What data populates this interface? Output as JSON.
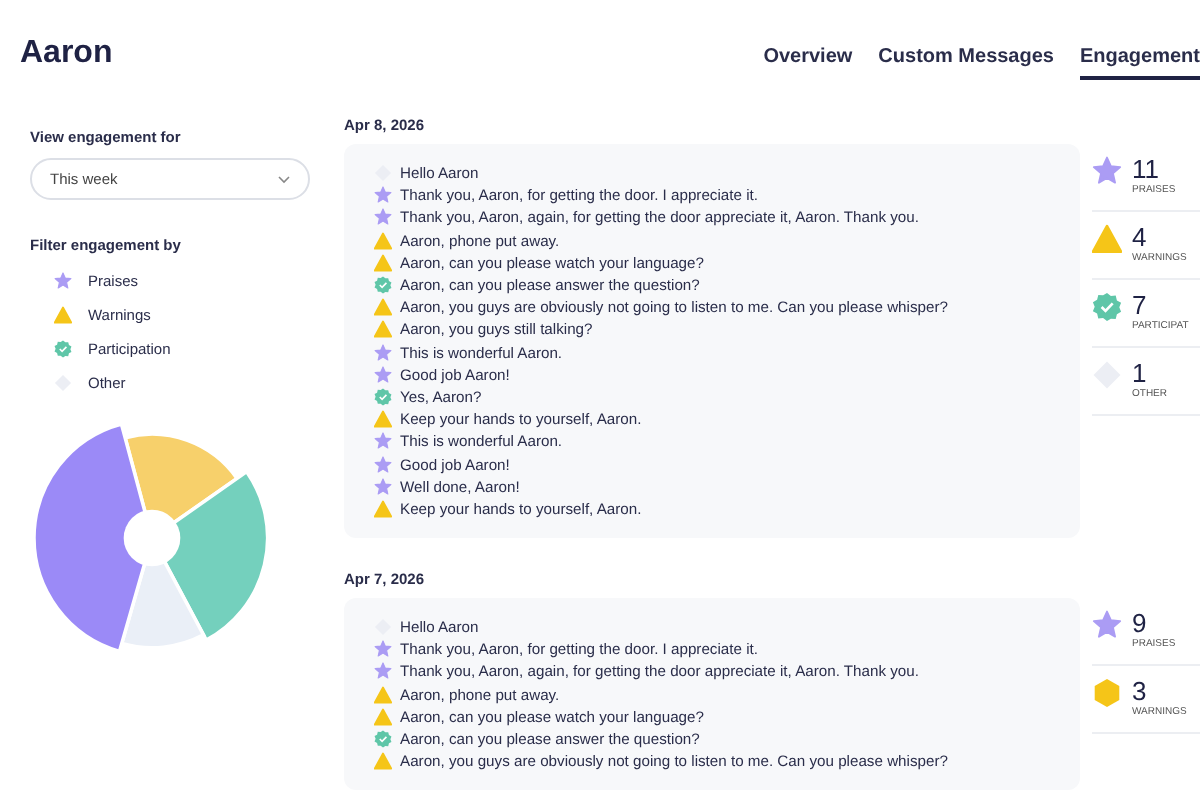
{
  "title": "Aaron",
  "tabs": [
    {
      "label": "Overview",
      "selected": false
    },
    {
      "label": "Custom Messages",
      "selected": false
    },
    {
      "label": "Engagement",
      "selected": true
    }
  ],
  "sidebar": {
    "period_label": "View engagement for",
    "period": {
      "value": "This week"
    },
    "filter_label": "Filter engagement by",
    "filters": [
      {
        "kind": "praise",
        "label": "Praises"
      },
      {
        "kind": "warning",
        "label": "Warnings"
      },
      {
        "kind": "participation",
        "label": "Participation"
      },
      {
        "kind": "other",
        "label": "Other"
      }
    ]
  },
  "days": [
    {
      "date": "Apr 8, 2026",
      "entries": [
        {
          "kind": "other",
          "text": "Hello Aaron"
        },
        {
          "kind": "praise",
          "text": "Thank you, Aaron, for getting the door. I appreciate it."
        },
        {
          "kind": "praise",
          "text": "Thank you, Aaron, again, for getting the door appreciate it, Aaron. Thank you."
        },
        {
          "kind": "warning",
          "text": "Aaron, phone put away."
        },
        {
          "kind": "warning",
          "text": "Aaron, can you please watch your language?"
        },
        {
          "kind": "participation",
          "text": "Aaron, can you please answer the question?"
        },
        {
          "kind": "warning",
          "text": "Aaron, you guys are obviously not going to listen to me. Can you please whisper?"
        },
        {
          "kind": "warning",
          "text": "Aaron, you guys still talking?"
        },
        {
          "kind": "praise",
          "text": "This is wonderful Aaron."
        },
        {
          "kind": "praise",
          "text": "Good job Aaron!"
        },
        {
          "kind": "participation",
          "text": "Yes, Aaron?"
        },
        {
          "kind": "warning",
          "text": "Keep your hands to yourself, Aaron."
        },
        {
          "kind": "praise",
          "text": "This is wonderful Aaron."
        },
        {
          "kind": "praise",
          "text": "Good job Aaron!"
        },
        {
          "kind": "praise",
          "text": "Well done, Aaron!"
        },
        {
          "kind": "warning",
          "text": "Keep your hands to yourself, Aaron."
        }
      ],
      "stats": [
        {
          "kind": "praise",
          "count": "11",
          "label": "PRAISES"
        },
        {
          "kind": "warning",
          "count": "4",
          "label": "WARNINGS"
        },
        {
          "kind": "participation",
          "count": "7",
          "label": "PARTICIPAT"
        },
        {
          "kind": "other",
          "count": "1",
          "label": "OTHER"
        }
      ]
    },
    {
      "date": "Apr 7, 2026",
      "entries": [
        {
          "kind": "other",
          "text": "Hello Aaron"
        },
        {
          "kind": "praise",
          "text": "Thank you, Aaron, for getting the door. I appreciate it."
        },
        {
          "kind": "praise",
          "text": "Thank you, Aaron, again, for getting the door appreciate it, Aaron. Thank you."
        },
        {
          "kind": "warning",
          "text": "Aaron, phone put away."
        },
        {
          "kind": "warning",
          "text": "Aaron, can you please watch your language?"
        },
        {
          "kind": "participation",
          "text": "Aaron, can you please answer the question?"
        },
        {
          "kind": "warning",
          "text": "Aaron, you guys are obviously not going to listen to me. Can you please whisper?"
        }
      ],
      "stats": [
        {
          "kind": "praise",
          "count": "9",
          "label": "PRAISES"
        },
        {
          "kind": "caution",
          "count": "3",
          "label": "WARNINGS"
        }
      ]
    }
  ]
}
